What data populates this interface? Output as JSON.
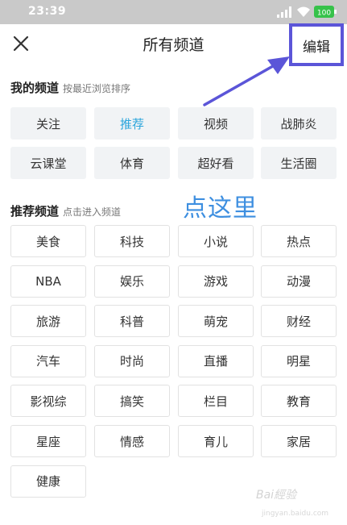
{
  "status": {
    "time": "23:39",
    "battery": "100"
  },
  "header": {
    "title": "所有频道",
    "edit_label": "编辑",
    "close_icon": "close-icon"
  },
  "my_section": {
    "title": "我的频道",
    "hint": "按最近浏览排序"
  },
  "my_channels": [
    "关注",
    "推荐",
    "视频",
    "战肺炎",
    "云课堂",
    "体育",
    "超好看",
    "生活圈"
  ],
  "rec_section": {
    "title": "推荐频道",
    "hint": "点击进入频道"
  },
  "rec_channels": [
    "美食",
    "科技",
    "小说",
    "热点",
    "NBA",
    "娱乐",
    "游戏",
    "动漫",
    "旅游",
    "科普",
    "萌宠",
    "财经",
    "汽车",
    "时尚",
    "直播",
    "明星",
    "影视综",
    "搞笑",
    "栏目",
    "教育",
    "星座",
    "情感",
    "育儿",
    "家居",
    "健康"
  ],
  "annotation": {
    "text": "点这里"
  },
  "watermark": {
    "text": "Bai經验",
    "url": "jingyan.baidu.com"
  },
  "colors": {
    "highlight": "#5b55d8",
    "active_channel": "#2aa5dc",
    "annotation": "#3e8fe0"
  }
}
